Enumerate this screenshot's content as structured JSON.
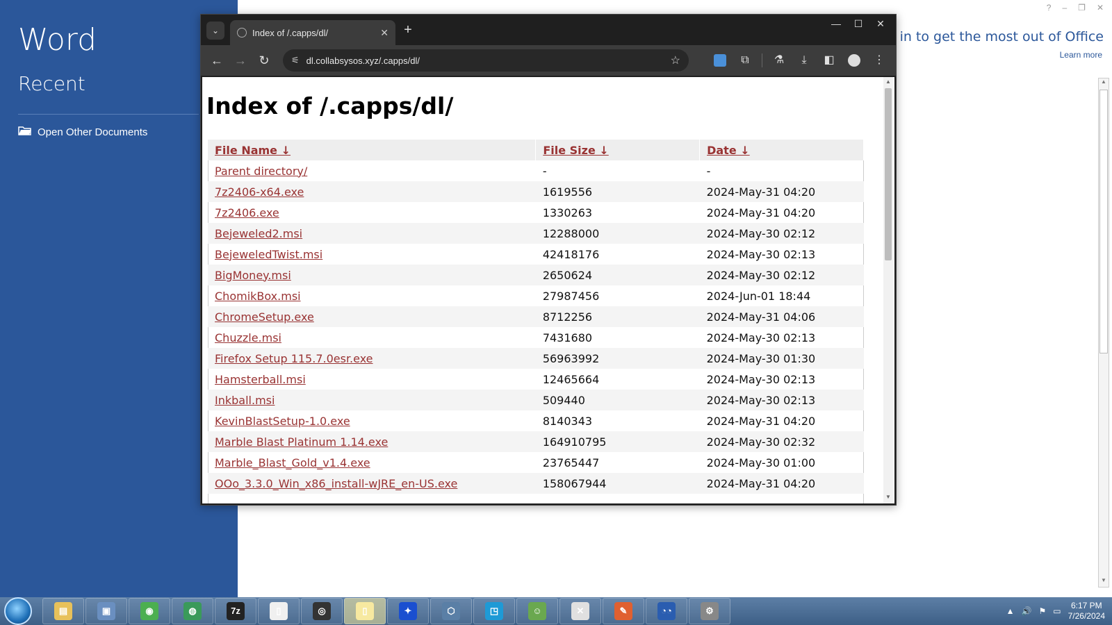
{
  "word": {
    "title": "Word",
    "recent": "Recent",
    "open_other": "Open Other Documents",
    "signin": "Sign in to get the most out of Office",
    "learn_more": "Learn more",
    "window_controls": [
      "?",
      "–",
      "❐",
      "✕"
    ]
  },
  "browser": {
    "tab_title": "Index of /.capps/dl/",
    "url": "dl.collabsysos.xyz/.capps/dl/",
    "window_controls": [
      "—",
      "☐",
      "✕"
    ]
  },
  "page": {
    "heading": "Index of /.capps/dl/",
    "columns": {
      "name": "File Name ↓",
      "size": "File Size ↓",
      "date": "Date ↓"
    },
    "rows": [
      {
        "name": "Parent directory/",
        "size": "-",
        "date": "-"
      },
      {
        "name": "7z2406-x64.exe",
        "size": "1619556",
        "date": "2024-May-31 04:20"
      },
      {
        "name": "7z2406.exe",
        "size": "1330263",
        "date": "2024-May-31 04:20"
      },
      {
        "name": "Bejeweled2.msi",
        "size": "12288000",
        "date": "2024-May-30 02:12"
      },
      {
        "name": "BejeweledTwist.msi",
        "size": "42418176",
        "date": "2024-May-30 02:13"
      },
      {
        "name": "BigMoney.msi",
        "size": "2650624",
        "date": "2024-May-30 02:12"
      },
      {
        "name": "ChomikBox.msi",
        "size": "27987456",
        "date": "2024-Jun-01 18:44"
      },
      {
        "name": "ChromeSetup.exe",
        "size": "8712256",
        "date": "2024-May-31 04:06"
      },
      {
        "name": "Chuzzle.msi",
        "size": "7431680",
        "date": "2024-May-30 02:13"
      },
      {
        "name": "Firefox Setup 115.7.0esr.exe",
        "size": "56963992",
        "date": "2024-May-30 01:30"
      },
      {
        "name": "Hamsterball.msi",
        "size": "12465664",
        "date": "2024-May-30 02:13"
      },
      {
        "name": "Inkball.msi",
        "size": "509440",
        "date": "2024-May-30 02:13"
      },
      {
        "name": "KevinBlastSetup-1.0.exe",
        "size": "8140343",
        "date": "2024-May-31 04:20"
      },
      {
        "name": "Marble Blast Platinum 1.14.exe",
        "size": "164910795",
        "date": "2024-May-30 02:32"
      },
      {
        "name": "Marble_Blast_Gold_v1.4.exe",
        "size": "23765447",
        "date": "2024-May-30 01:00"
      },
      {
        "name": "OOo_3.3.0_Win_x86_install-wJRE_en-US.exe",
        "size": "158067944",
        "date": "2024-May-31 04:20"
      }
    ]
  },
  "taskbar": {
    "tasks": [
      {
        "icon": "folder-icon",
        "color": "#e8c15a",
        "glyph": "▤"
      },
      {
        "icon": "computer-icon",
        "color": "#6a8fc0",
        "glyph": "▣"
      },
      {
        "icon": "chrome-icon",
        "color": "#4caf50",
        "glyph": "◉"
      },
      {
        "icon": "globe-icon",
        "color": "#3a9a5a",
        "glyph": "◍"
      },
      {
        "icon": "7zip-icon",
        "color": "#222222",
        "glyph": "7z"
      },
      {
        "icon": "document-icon",
        "color": "#f0f0f0",
        "glyph": "▯"
      },
      {
        "icon": "obs-icon",
        "color": "#333333",
        "glyph": "◎"
      },
      {
        "icon": "notes-icon",
        "color": "#f7e9a0",
        "glyph": "▯"
      },
      {
        "icon": "virtualbox-icon",
        "color": "#1a4fd0",
        "glyph": "✦"
      },
      {
        "icon": "3d-box-icon",
        "color": "#5a7fa6",
        "glyph": "⬡"
      },
      {
        "icon": "window-icon",
        "color": "#1e9ad6",
        "glyph": "◳"
      },
      {
        "icon": "people-icon",
        "color": "#6aa84f",
        "glyph": "☺"
      },
      {
        "icon": "uninstall-icon",
        "color": "#e0e0e0",
        "glyph": "✕"
      },
      {
        "icon": "paint-icon",
        "color": "#e06030",
        "glyph": "✎"
      },
      {
        "icon": "eyes-icon",
        "color": "#2a5db0",
        "glyph": "◔◔"
      },
      {
        "icon": "settings-gear-icon",
        "color": "#888888",
        "glyph": "⚙"
      }
    ],
    "active_index": 7,
    "time": "6:17 PM",
    "date": "7/26/2024"
  }
}
